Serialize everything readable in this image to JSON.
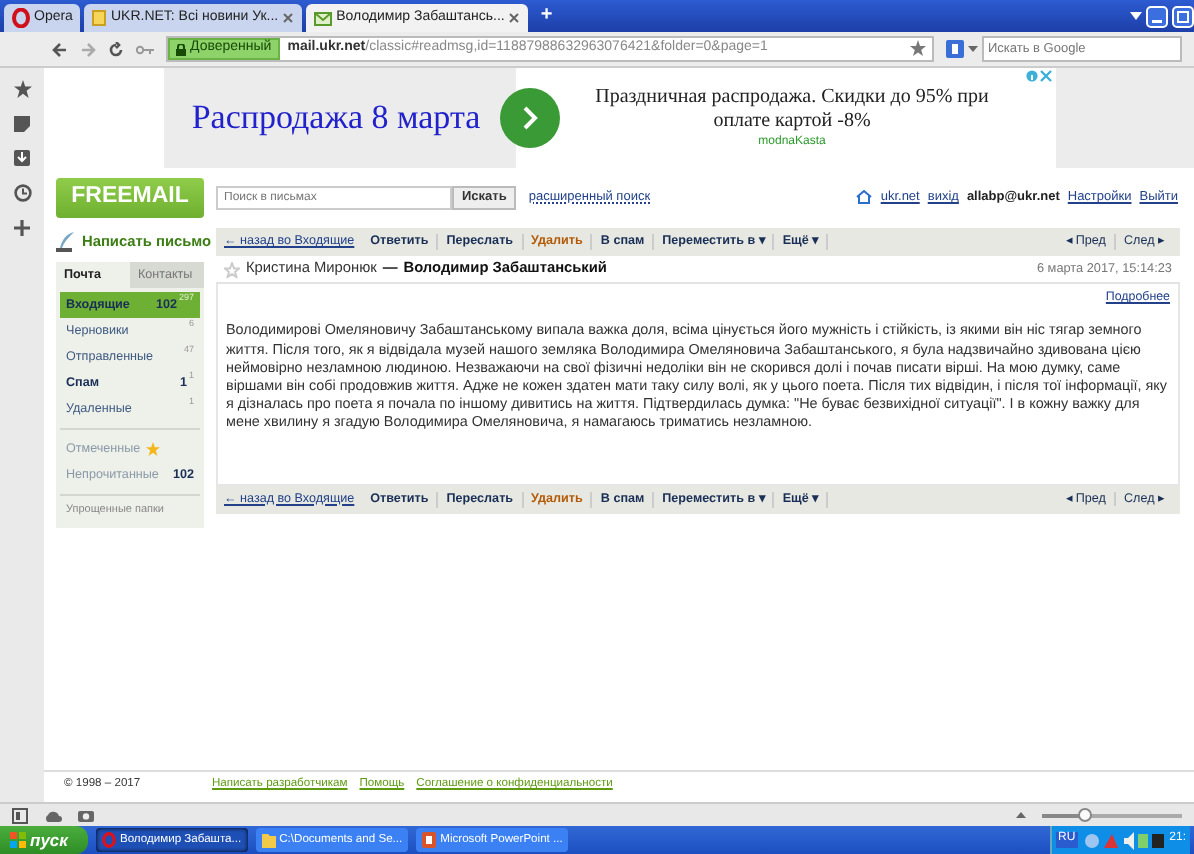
{
  "browser": {
    "tabs": [
      {
        "label": "Opera",
        "kind": "menu",
        "selected": false
      },
      {
        "label": "UKR.NET: Всі новини Ук...",
        "kind": "page",
        "selected": false
      },
      {
        "label": "Володимир Забаштансь...",
        "kind": "page",
        "selected": true
      }
    ],
    "new_tab": "+",
    "address": {
      "security": "Доверенный",
      "host": "mail.ukr.net",
      "path": "/classic#readmsg,id=11887988632963076421&folder=0&page=1"
    },
    "search": {
      "placeholder": "Искать в Google"
    }
  },
  "ad": {
    "headline": "Распродажа 8 марта",
    "text": "Праздничная распродажа. Скидки до 95% при оплате картой -8%",
    "source": "modnaKasta"
  },
  "mail": {
    "logo": "FREEMAIL",
    "search": {
      "placeholder": "Поиск в письмах",
      "button": "Искать",
      "advanced": "расширенный поиск"
    },
    "top_links": [
      {
        "label": "ukr.net",
        "kind": "home"
      },
      {
        "label": "вихід",
        "kind": "link"
      },
      {
        "label": "allabp@ukr.net",
        "kind": "user"
      },
      {
        "label": "Настройки",
        "kind": "link"
      },
      {
        "label": "Выйти",
        "kind": "link"
      }
    ],
    "compose": "Написать письмо",
    "side_tabs": [
      {
        "label": "Почта",
        "selected": true
      },
      {
        "label": "Контакты",
        "selected": false
      }
    ],
    "folders": [
      {
        "name": "Входящие",
        "count": "102",
        "total": "297",
        "selected": true,
        "unread": true
      },
      {
        "name": "Черновики",
        "total": "6",
        "selected": false,
        "unread": false
      },
      {
        "name": "Отправленные",
        "total": "47",
        "selected": false,
        "unread": false
      },
      {
        "name": "Спам",
        "count": "1",
        "total": "1",
        "selected": false,
        "unread": true
      },
      {
        "name": "Удаленные",
        "total": "1",
        "selected": false,
        "unread": false
      }
    ],
    "filters": [
      {
        "name": "Отмеченные",
        "kind": "starred"
      },
      {
        "name": "Непрочитанные",
        "count": "102",
        "kind": "unread"
      }
    ],
    "manage": "Упрощенные папки",
    "toolbars": [
      {
        "items": [
          {
            "label": "← назад во Входящие",
            "kind": "back"
          },
          {
            "label": "Ответить",
            "kind": "action"
          },
          {
            "label": "Переслать",
            "kind": "action"
          },
          {
            "label": "Удалить",
            "kind": "danger"
          },
          {
            "label": "В спам",
            "kind": "action"
          },
          {
            "label": "Переместить в ▾",
            "kind": "action"
          },
          {
            "label": "Ещё ▾",
            "kind": "action"
          }
        ],
        "nav": [
          "◂ Пред",
          "След ▸"
        ]
      },
      {
        "items": [
          {
            "label": "← назад во Входящие",
            "kind": "back"
          },
          {
            "label": "Ответить",
            "kind": "action"
          },
          {
            "label": "Переслать",
            "kind": "action"
          },
          {
            "label": "Удалить",
            "kind": "danger"
          },
          {
            "label": "В спам",
            "kind": "action"
          },
          {
            "label": "Переместить в ▾",
            "kind": "action"
          },
          {
            "label": "Ещё ▾",
            "kind": "action"
          }
        ],
        "nav": [
          "◂ Пред",
          "След ▸"
        ]
      }
    ],
    "message": {
      "starred": false,
      "from": "Кристина Миронюк",
      "dash": "—",
      "to": "Володимир Забаштанський",
      "date": "6 марта 2017, 15:14:23",
      "details": "Подробнее",
      "body": "Володимирові Омеляновичу Забаштанському випала важка доля, всіма цінується його мужність і стійкість, із якими він ніс тягар земного життя. Після того, як я відвідала музей нашого земляка Володимира Омеляновича Забаштанського,  я була надзвичайно здивована цією неймовірно незламною людиною. Незважаючи на свої фізичні недоліки він не скорився долі і почав писати вірші. На мою думку, саме віршами він собі продовжив життя. Адже не кожен здатен мати таку силу волі, як у цього поета. Після тих відвідин, і після тої інформації, яку я дізналась про поета я почала по іншому дивитись на життя. Підтвердилась думка: \"Не буває безвихідної ситуації\". І в кожну важку для мене хвилину я згадую Володимира Омеляновича, я намагаюсь триматись незламною."
    },
    "footer": {
      "copyright": "© 1998 – 2017",
      "links": [
        "Написать разработчикам",
        "Помощь",
        "Соглашение о конфиденциальности"
      ]
    }
  },
  "status_bar": {
    "zoom": {
      "level": 0.32
    }
  },
  "taskbar": {
    "start": "пуск",
    "items": [
      {
        "label": "Володимир Забашта...",
        "kind": "opera",
        "selected": true
      },
      {
        "label": "C:\\Documents and Se...",
        "kind": "folder",
        "selected": false
      },
      {
        "label": "Microsoft PowerPoint ...",
        "kind": "powerpoint",
        "selected": false
      }
    ],
    "language": "RU",
    "clock": "21:"
  }
}
